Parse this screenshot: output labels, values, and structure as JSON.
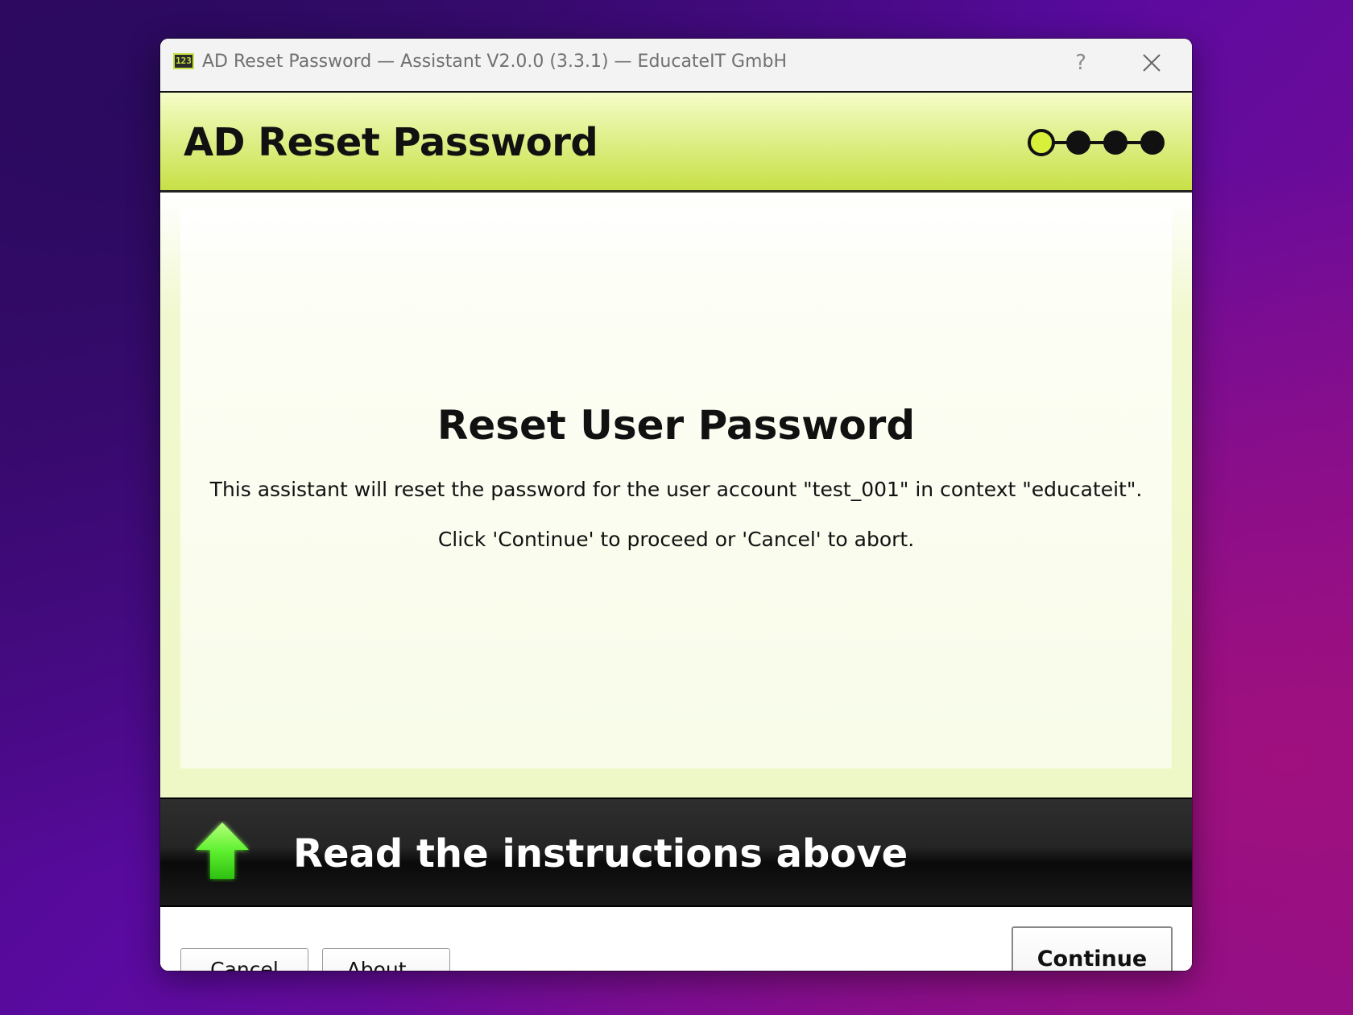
{
  "window": {
    "title": "AD Reset Password — Assistant V2.0.0 (3.3.1) — EducateIT GmbH",
    "app_icon_text": "123",
    "help_label": "?",
    "close_icon": "close-icon"
  },
  "header": {
    "title": "AD Reset Password",
    "steps": {
      "total": 4,
      "current": 1
    },
    "accent_color": "#d8f03a"
  },
  "content": {
    "heading": "Reset User Password",
    "description": "This assistant will reset the password for the user account \"test_001\" in context \"educateit\".",
    "instruction": "Click 'Continue' to proceed or 'Cancel' to abort."
  },
  "banner": {
    "icon": "up-arrow-icon",
    "text": "Read the instructions above"
  },
  "buttons": {
    "cancel": "Cancel",
    "about": "About...",
    "continue": "Continue"
  }
}
